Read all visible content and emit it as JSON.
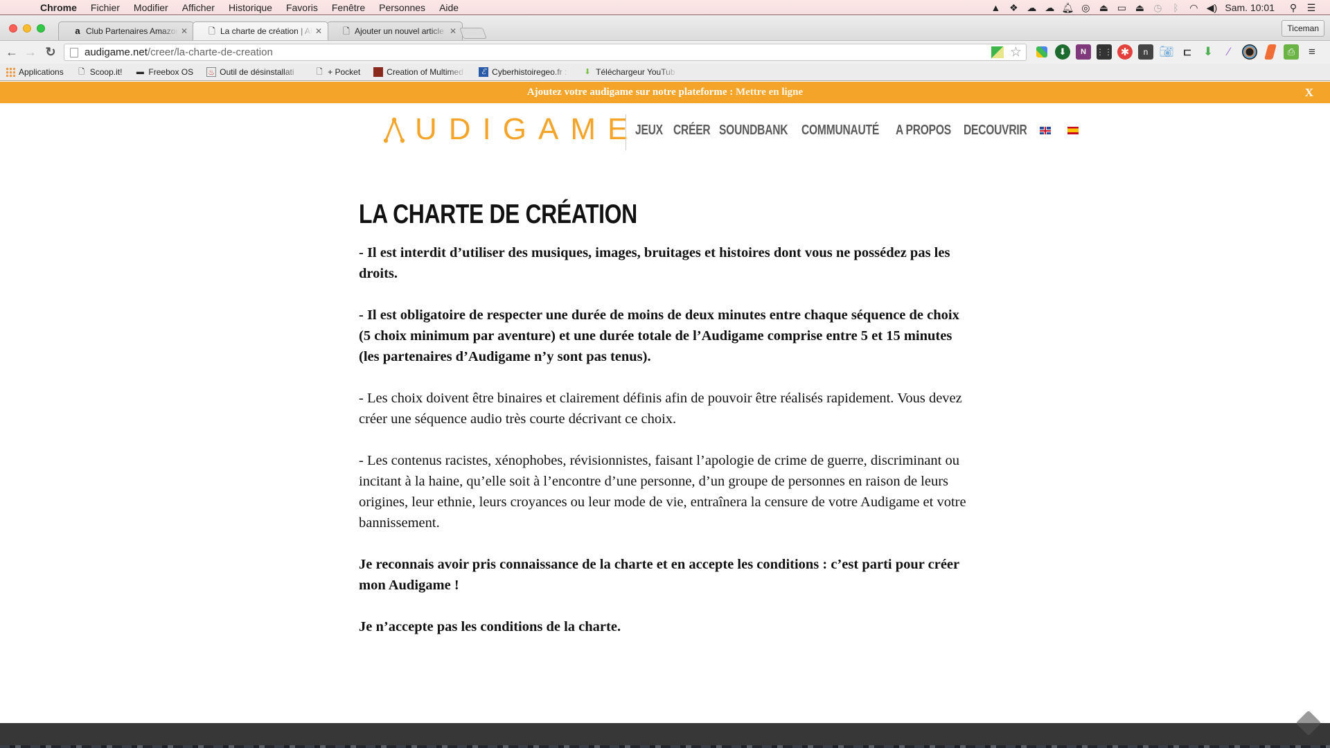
{
  "menubar": {
    "app": "Chrome",
    "items": [
      "Fichier",
      "Modifier",
      "Afficher",
      "Historique",
      "Favoris",
      "Fenêtre",
      "Personnes",
      "Aide"
    ],
    "status_icons": [
      "google-drive",
      "dropbox",
      "evernote-elephant",
      "onedrive-cloud",
      "notifications-bell",
      "creative-cloud",
      "screen-share",
      "airplay",
      "eject",
      "time-machine",
      "bluetooth",
      "wifi",
      "volume"
    ],
    "clock": "Sam. 10:01"
  },
  "browser": {
    "tabs": [
      {
        "title": "Club Partenaires Amazon.fr",
        "favicon": "a",
        "active": false
      },
      {
        "title": "La charte de création | AUDIGAME",
        "favicon": "page",
        "active": true
      },
      {
        "title": "Ajouter un nouvel article ‹ L",
        "favicon": "page",
        "active": false
      }
    ],
    "profile": "Ticeman",
    "url_domain": "audigame.net",
    "url_path": "/creer/la-charte-de-creation",
    "bookmarks": [
      {
        "label": "Applications",
        "icon": "apps-grid"
      },
      {
        "label": "Scoop.it!",
        "icon": "page"
      },
      {
        "label": "Freebox OS",
        "icon": "freebox"
      },
      {
        "label": "Outil de désinstallati",
        "icon": "java"
      },
      {
        "label": "+ Pocket",
        "icon": "page"
      },
      {
        "label": "Creation of Multimed",
        "icon": "photo"
      },
      {
        "label": "Cyberhistoiregeo.fr :",
        "icon": "e-logo"
      },
      {
        "label": "Téléchargeur YouTub",
        "icon": "download-arrow"
      }
    ],
    "extensions": [
      "puzzle-tiles",
      "download-green",
      "onenote",
      "film-strip",
      "asterisk-red",
      "notify-n",
      "camera",
      "bracket",
      "arrow-down-green",
      "feather-quill",
      "color-wheel",
      "eraser-orange",
      "print-green"
    ]
  },
  "promo": {
    "text": "Ajoutez votre audigame sur notre plateforme : ",
    "link": "Mettre en ligne",
    "close": "X"
  },
  "site": {
    "logo": "AUDIGAME",
    "accent": "#f5a42a",
    "nav": [
      "JEUX",
      "CRÉER",
      "SOUNDBANK",
      "COMMUNAUTÉ",
      "A PROPOS",
      "DECOUVRIR"
    ],
    "languages": [
      "English",
      "Español"
    ]
  },
  "page": {
    "title": "LA CHARTE DE CRÉATION",
    "rules": [
      "- Il est interdit d’utiliser des musiques, images, bruitages et histoires dont vous ne possédez pas les droits.",
      "- Il est obligatoire de respecter une durée de moins de deux minutes entre chaque séquence de choix (5 choix minimum par aventure) et une durée totale de l’Audigame comprise entre 5 et 15 minutes (les partenaires d’Audigame n’y sont pas tenus).",
      "- Les choix doivent être binaires et clairement définis afin de pouvoir être réalisés rapidement. Vous devez créer une séquence audio très courte décrivant ce choix.",
      "- Les contenus racistes, xénophobes, révisionnistes, faisant l’apologie de crime de guerre, discriminant ou incitant à la haine, qu’elle soit à l’encontre d’une personne, d’un groupe de personnes en raison de leurs origines, leur ethnie, leurs croyances ou leur mode de vie, entraînera la censure de votre Audigame et votre bannissement."
    ],
    "accept": "Je reconnais avoir pris connaissance de la charte et en accepte les conditions : c’est parti pour créer mon Audigame !",
    "decline": "Je n’accepte pas les conditions de la charte."
  }
}
